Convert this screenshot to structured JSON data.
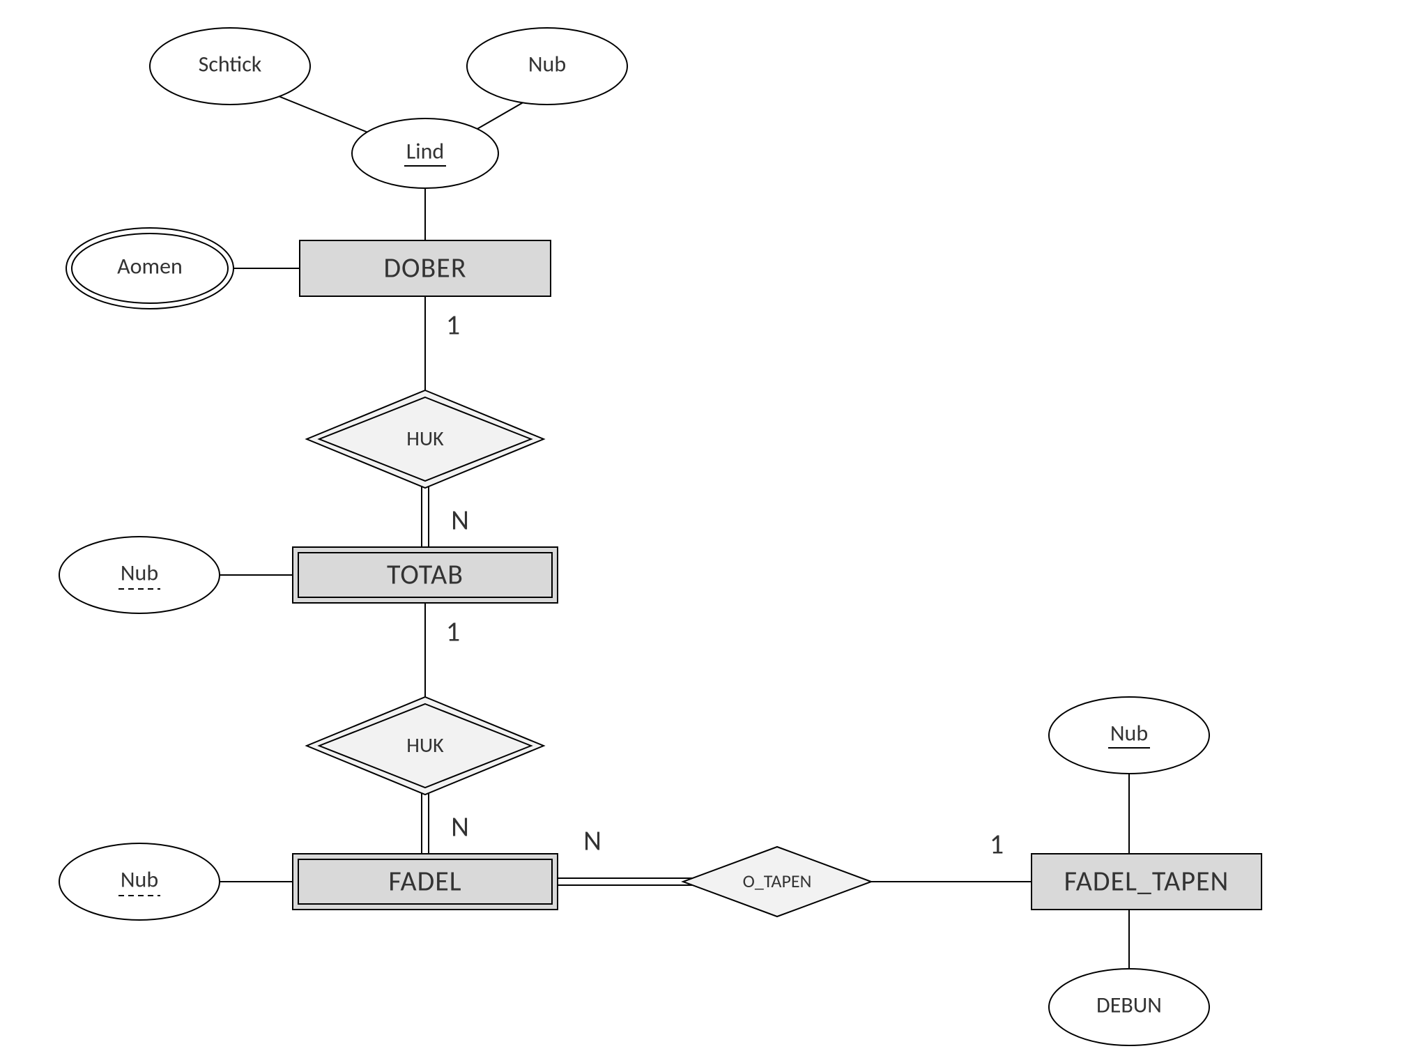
{
  "entities": {
    "dober": "DOBER",
    "totab": "TOTAB",
    "fadel": "FADEL",
    "fadel_tapen": "FADEL_TAPEN"
  },
  "relationships": {
    "huk1": "HUK",
    "huk2": "HUK",
    "o_tapen": "O_TAPEN"
  },
  "attributes": {
    "schtick": "Schtick",
    "nub_top": "Nub",
    "lind": "Lind",
    "aomen": "Aomen",
    "nub_totab": "Nub",
    "nub_fadel": "Nub",
    "nub_ft": "Nub",
    "debun": "DEBUN"
  },
  "cardinalities": {
    "c1": "1",
    "cN1": "N",
    "c2": "1",
    "cN2": "N",
    "cN3": "N",
    "c3": "1"
  }
}
